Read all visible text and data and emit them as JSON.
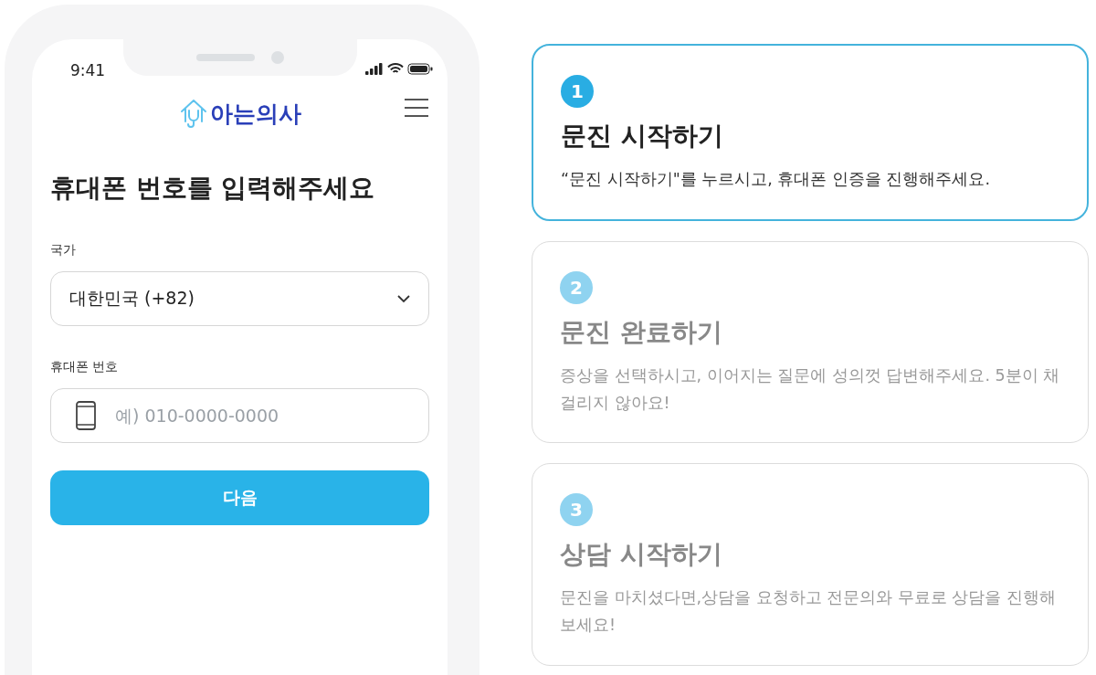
{
  "phone": {
    "status_bar": {
      "time": "9:41"
    },
    "logo": {
      "text": "아는의사"
    },
    "title": "휴대폰 번호를 입력해주세요",
    "country": {
      "label": "국가",
      "value": "대한민국 (+82)"
    },
    "phone_number": {
      "label": "휴대폰 번호",
      "placeholder": "예) 010-0000-0000"
    },
    "next_button": "다음"
  },
  "steps": [
    {
      "number": "1",
      "title": "문진 시작하기",
      "description": "“문진 시작하기\"를 누르시고, 휴대폰 인증을 진행해주세요.",
      "selected": true
    },
    {
      "number": "2",
      "title": "문진 완료하기",
      "description": "증상을 선택하시고, 이어지는 질문에 성의껏 답변해주세요. 5분이 채 걸리지 않아요!",
      "selected": false
    },
    {
      "number": "3",
      "title": "상담 시작하기",
      "description": "문진을 마치셨다면,상담을 요청하고 전문의와 무료로 상담을 진행해보세요!",
      "selected": false
    }
  ]
}
